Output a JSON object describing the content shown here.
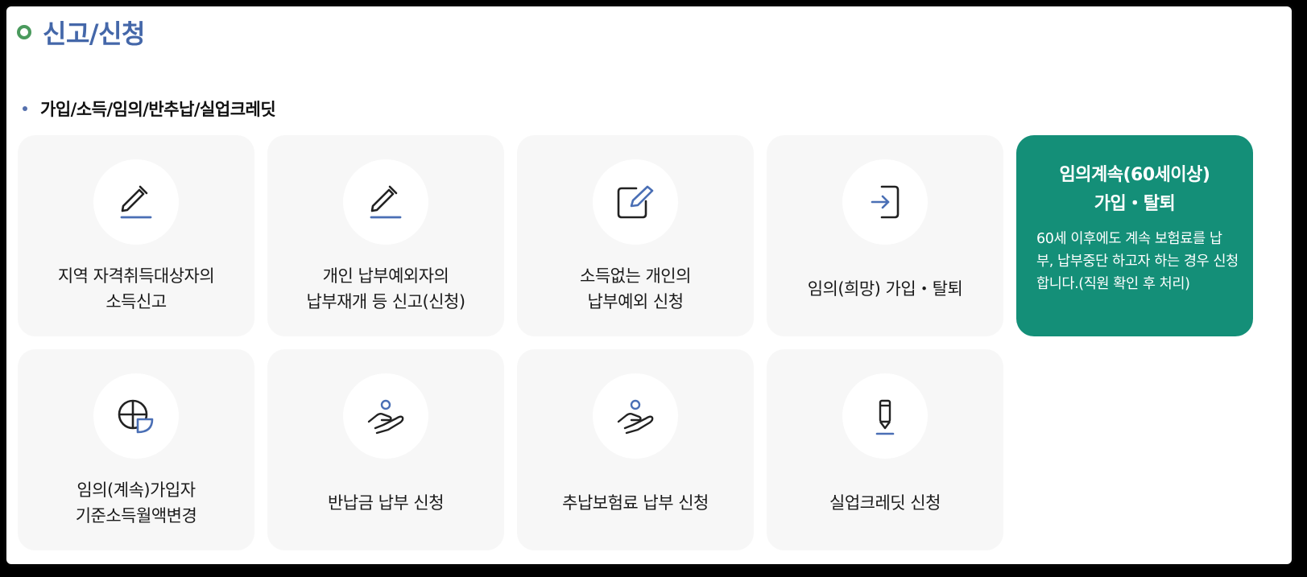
{
  "page_title": "신고/신청",
  "section_title": "가입/소득/임의/반추납/실업크레딧",
  "colors": {
    "title": "#4467a9",
    "bullet": "#4a9a5d",
    "card_bg": "#f7f7f7",
    "active_bg": "#148f78",
    "icon_accent": "#4a6fb5",
    "icon_dark": "#222222"
  },
  "cards": [
    {
      "icon": "pencil-icon",
      "label": "지역 자격취득대상자의\n소득신고"
    },
    {
      "icon": "pencil-icon",
      "label": "개인 납부예외자의\n납부재개 등 신고(신청)"
    },
    {
      "icon": "edit-note-icon",
      "label": "소득없는 개인의\n납부예외 신청"
    },
    {
      "icon": "sign-in-icon",
      "label": "임의(희망) 가입・탈퇴"
    },
    {
      "title": "임의계속(60세이상)\n가입・탈퇴",
      "description": "60세 이후에도 계속 보험료를 납부, 납부중단 하고자 하는 경우 신청합니다.(직원 확인 후 처리)"
    },
    {
      "icon": "pie-chart-icon",
      "label": "임의(계속)가입자\n기준소득월액변경"
    },
    {
      "icon": "hand-person-icon",
      "label": "반납금 납부 신청"
    },
    {
      "icon": "hand-person-icon",
      "label": "추납보험료 납부 신청"
    },
    {
      "icon": "pen-icon",
      "label": "실업크레딧 신청"
    }
  ]
}
